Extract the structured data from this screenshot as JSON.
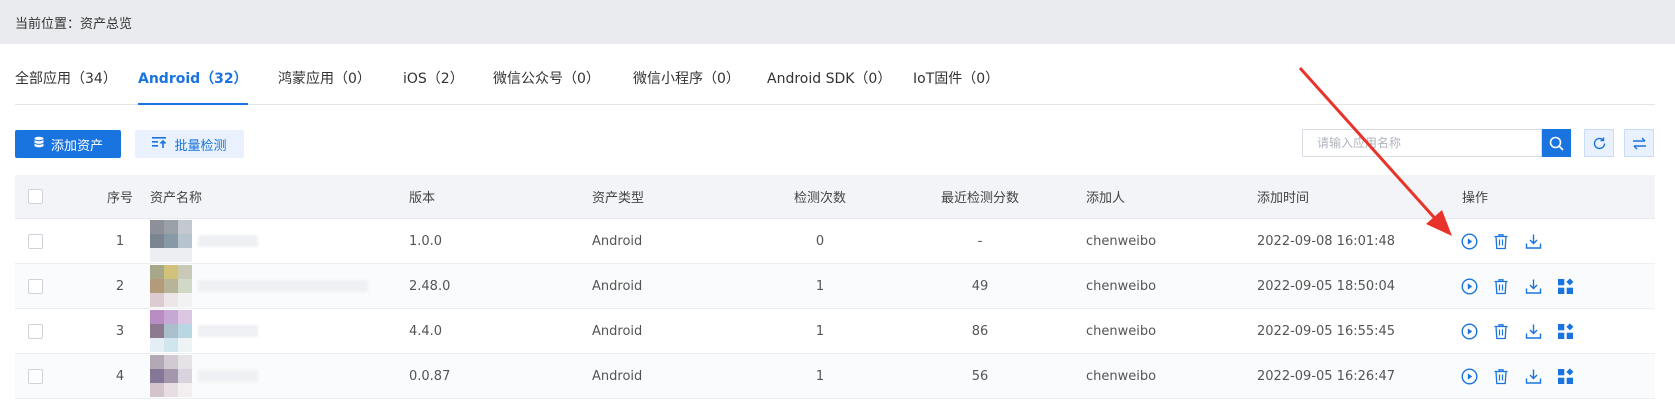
{
  "breadcrumb": {
    "text": "当前位置：资产总览"
  },
  "tabs": [
    {
      "label": "全部应用（34）",
      "active": false
    },
    {
      "label": "Android（32）",
      "active": true
    },
    {
      "label": "鸿蒙应用（0）",
      "active": false
    },
    {
      "label": "iOS（2）",
      "active": false
    },
    {
      "label": "微信公众号（0）",
      "active": false
    },
    {
      "label": "微信小程序（0）",
      "active": false
    },
    {
      "label": "Android SDK（0）",
      "active": false
    },
    {
      "label": "IoT固件（0）",
      "active": false
    }
  ],
  "toolbar": {
    "add_label": "添加资产",
    "batch_label": "批量检测",
    "search_placeholder": "请输入应用名称"
  },
  "table": {
    "headers": [
      "序号",
      "资产名称",
      "版本",
      "资产类型",
      "检测次数",
      "最近检测分数",
      "添加人",
      "添加时间",
      "操作"
    ],
    "rows": [
      {
        "index": "1",
        "version": "1.0.0",
        "type": "Android",
        "scans": "0",
        "score": "-",
        "user": "chenweibo",
        "time": "2022-09-08 16:01:48",
        "has_report": false,
        "thumb": [
          "#8d9099",
          "#9aa0a8",
          "#c4c8cf",
          "#7a8591",
          "#8799a6",
          "#b8c4cd",
          "#eceef1",
          "#eceef1",
          "#eceef1"
        ]
      },
      {
        "index": "2",
        "version": "2.48.0",
        "type": "Android",
        "scans": "1",
        "score": "49",
        "user": "chenweibo",
        "time": "2022-09-05 18:50:04",
        "has_report": true,
        "thumb": [
          "#a7a78a",
          "#d2c17a",
          "#c9c9b8",
          "#b39b7a",
          "#b8b49a",
          "#d2d8c6",
          "#dccbd0",
          "#ece6e8",
          "#f2f2f2"
        ]
      },
      {
        "index": "3",
        "version": "4.4.0",
        "type": "Android",
        "scans": "1",
        "score": "86",
        "user": "chenweibo",
        "time": "2022-09-05 16:55:45",
        "has_report": true,
        "thumb": [
          "#b98cc3",
          "#c6a7d6",
          "#dcc7e2",
          "#8d7a91",
          "#a9c0cc",
          "#b9d6e3",
          "#e4eef4",
          "#cfe6ee",
          "#eef4f6"
        ]
      },
      {
        "index": "4",
        "version": "0.0.87",
        "type": "Android",
        "scans": "1",
        "score": "56",
        "user": "chenweibo",
        "time": "2022-09-05 16:26:47",
        "has_report": true,
        "thumb": [
          "#b3a9b6",
          "#d1cad3",
          "#e6e3e7",
          "#857896",
          "#a497ad",
          "#d8d3dc",
          "#d5c3cc",
          "#e8dde2",
          "#f3eef0"
        ]
      }
    ]
  },
  "colors": {
    "accent": "#1a74e0",
    "annotation": "#e8332b"
  },
  "icons": {
    "play": "play-circle-icon",
    "delete": "trash-icon",
    "download": "download-icon",
    "report": "apps-grid-icon"
  }
}
